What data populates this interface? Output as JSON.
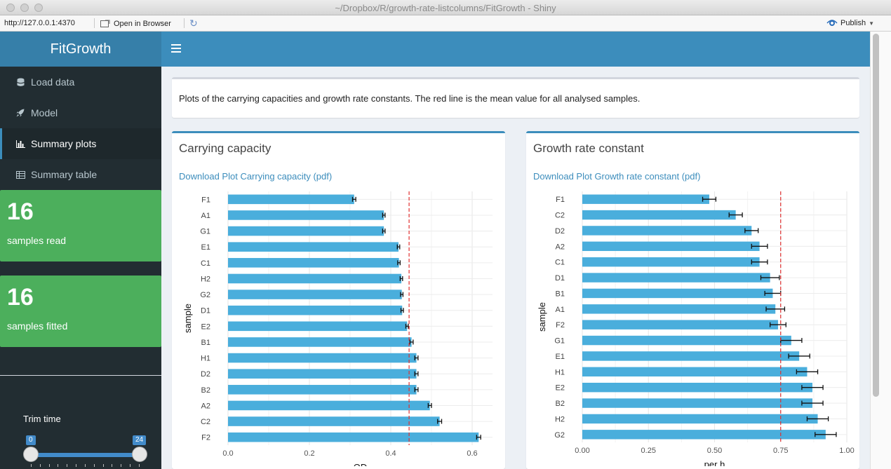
{
  "window": {
    "title": "~/Dropbox/R/growth-rate-listcolumns/FitGrowth - Shiny"
  },
  "toolbar": {
    "url": "http://127.0.0.1:4370",
    "open_browser": "Open in Browser",
    "publish": "Publish"
  },
  "app": {
    "logo": "FitGrowth"
  },
  "sidebar": {
    "items": [
      {
        "label": "Load data",
        "icon": "database-icon"
      },
      {
        "label": "Model",
        "icon": "rocket-icon"
      },
      {
        "label": "Summary plots",
        "icon": "bar-chart-icon"
      },
      {
        "label": "Summary table",
        "icon": "table-icon"
      }
    ],
    "active": 2,
    "samples_read": {
      "value": "16",
      "label": "samples read"
    },
    "samples_fitted": {
      "value": "16",
      "label": "samples fitted"
    },
    "trim_time": {
      "label": "Trim time",
      "min": "0",
      "max": "24"
    }
  },
  "info": {
    "text": "Plots of the carrying capacities and growth rate constants. The red line is the mean value for all analysed samples."
  },
  "colors": {
    "bar": "#4aaedc",
    "mean_line": "#e03030",
    "header": "#3c8dbc",
    "valuebox": "#4caf5c"
  },
  "chart_data": [
    {
      "type": "bar",
      "orientation": "horizontal",
      "title": "Carrying capacity",
      "download_label": "Download Plot Carrying capacity (pdf)",
      "xlabel": "OD",
      "ylabel": "sample",
      "xlim": [
        0,
        0.65
      ],
      "xticks": [
        0.0,
        0.2,
        0.4,
        0.6
      ],
      "xtick_labels": [
        "0.0",
        "0.2",
        "0.4",
        "0.6"
      ],
      "mean": 0.445,
      "categories": [
        "F1",
        "A1",
        "G1",
        "E1",
        "C1",
        "H2",
        "G2",
        "D1",
        "E2",
        "B1",
        "H1",
        "D2",
        "B2",
        "A2",
        "C2",
        "F2"
      ],
      "values": [
        0.31,
        0.383,
        0.383,
        0.419,
        0.42,
        0.426,
        0.427,
        0.428,
        0.44,
        0.451,
        0.463,
        0.463,
        0.463,
        0.496,
        0.52,
        0.616
      ],
      "errors": [
        0.004,
        0.003,
        0.003,
        0.003,
        0.003,
        0.003,
        0.003,
        0.003,
        0.003,
        0.004,
        0.004,
        0.004,
        0.004,
        0.004,
        0.005,
        0.005
      ]
    },
    {
      "type": "bar",
      "orientation": "horizontal",
      "title": "Growth rate constant",
      "download_label": "Download Plot Growth rate constant (pdf)",
      "xlabel": "per h",
      "ylabel": "sample",
      "xlim": [
        0,
        1.0
      ],
      "xticks": [
        0.0,
        0.25,
        0.5,
        0.75,
        1.0
      ],
      "xtick_labels": [
        "0.00",
        "0.25",
        "0.50",
        "0.75",
        "1.00"
      ],
      "mean": 0.75,
      "categories": [
        "F1",
        "C2",
        "D2",
        "A2",
        "C1",
        "D1",
        "B1",
        "A1",
        "F2",
        "G1",
        "E1",
        "H1",
        "E2",
        "B2",
        "H2",
        "G2"
      ],
      "values": [
        0.48,
        0.58,
        0.64,
        0.67,
        0.67,
        0.71,
        0.72,
        0.73,
        0.74,
        0.79,
        0.82,
        0.85,
        0.87,
        0.87,
        0.89,
        0.92
      ],
      "errors": [
        0.025,
        0.025,
        0.025,
        0.03,
        0.03,
        0.035,
        0.03,
        0.035,
        0.03,
        0.04,
        0.04,
        0.04,
        0.04,
        0.04,
        0.04,
        0.04
      ]
    }
  ]
}
